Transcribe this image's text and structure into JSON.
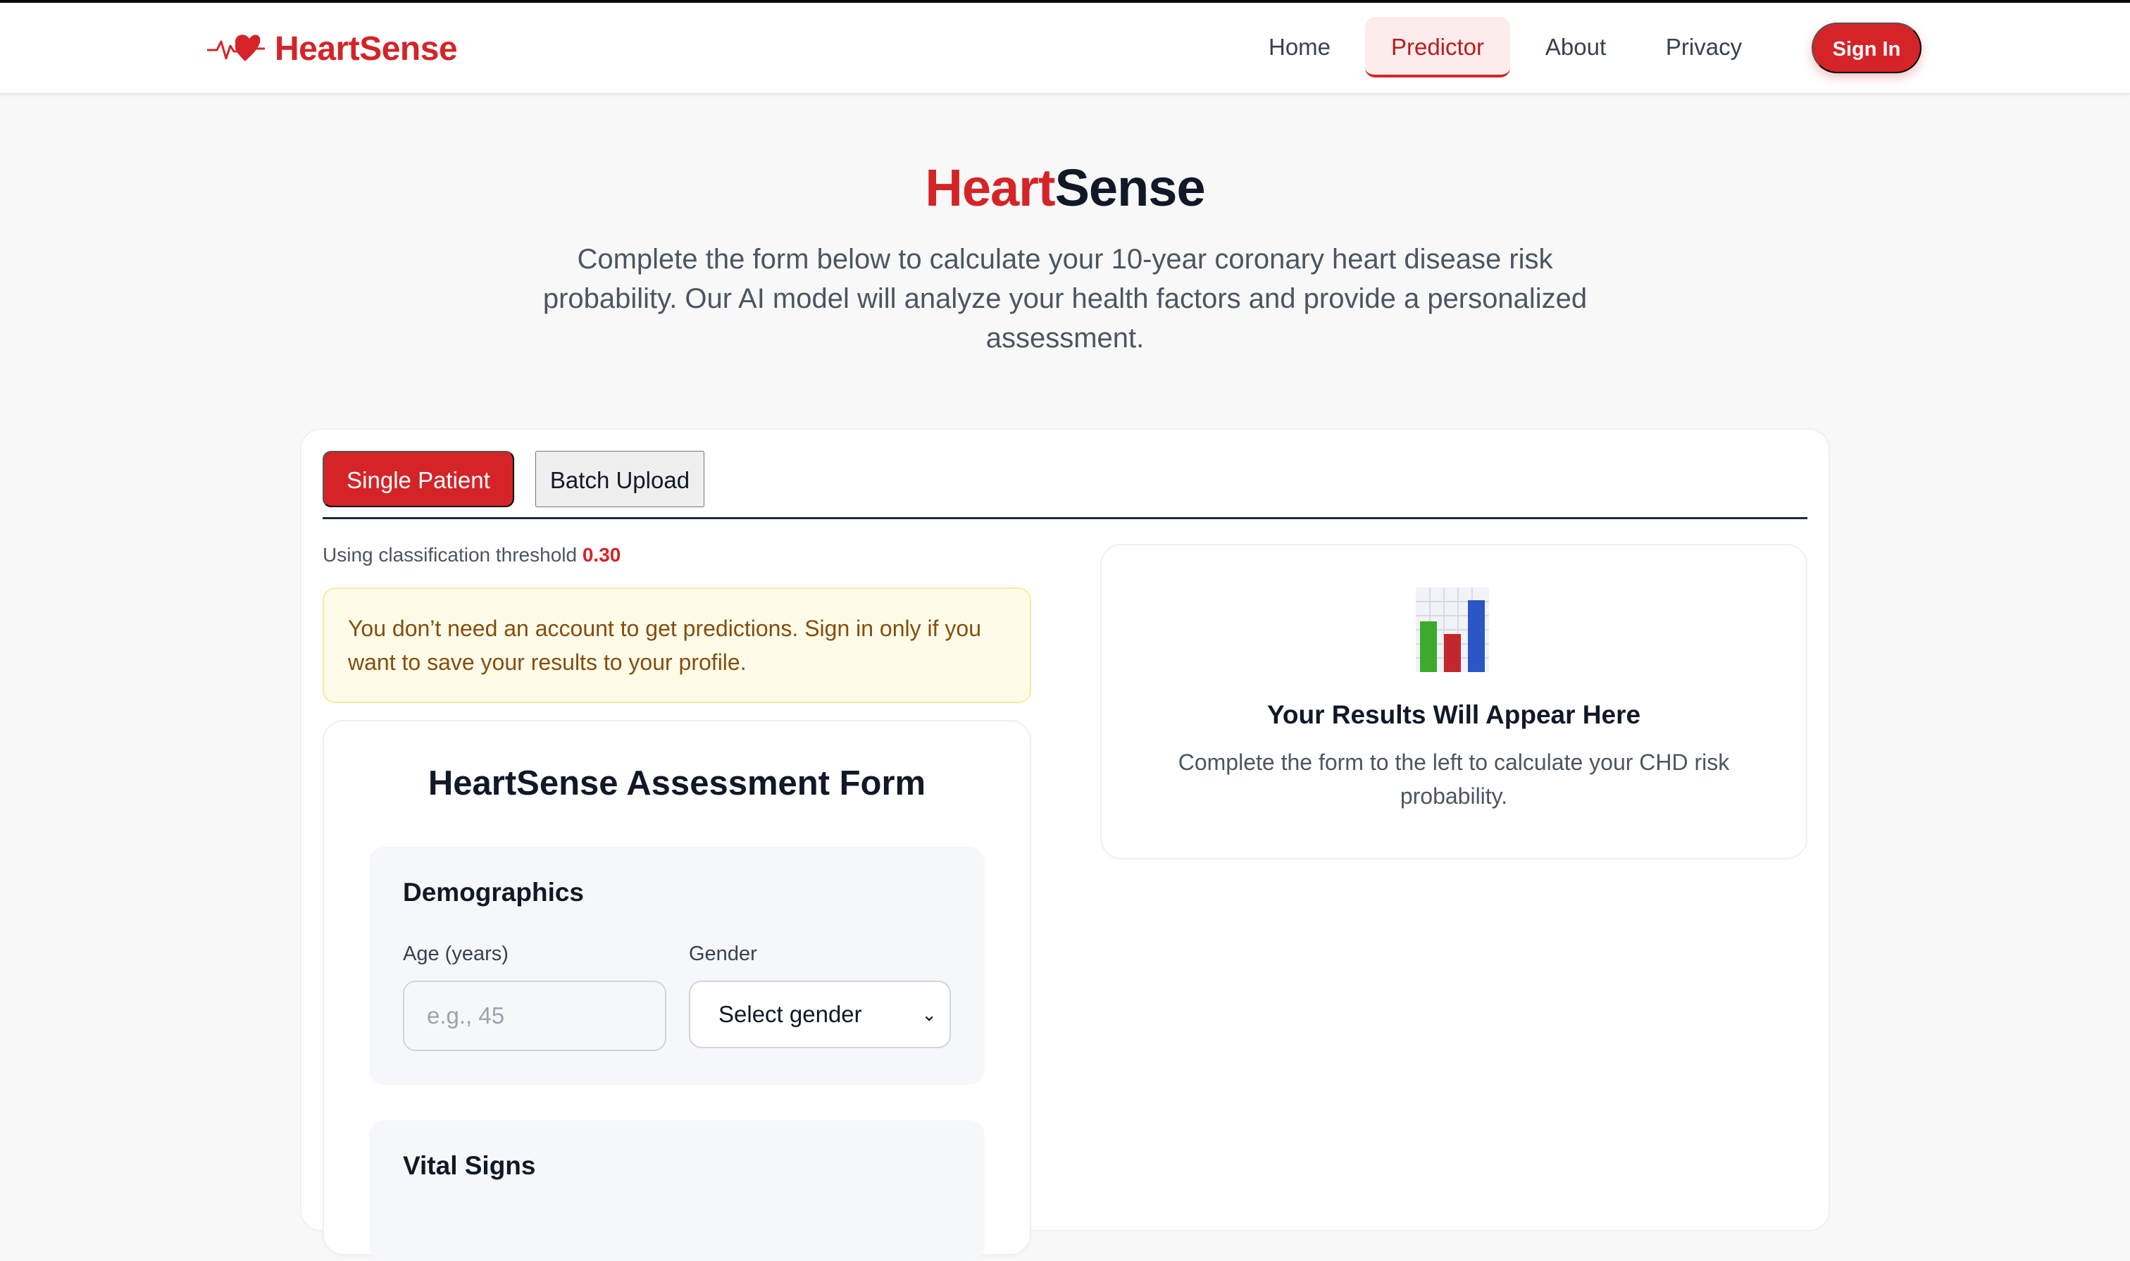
{
  "nav": {
    "brand": "HeartSense",
    "links": [
      "Home",
      "Predictor",
      "About",
      "Privacy"
    ],
    "active": "Predictor",
    "signin": "Sign In"
  },
  "hero": {
    "title_red": "Heart",
    "title_dark": "Sense",
    "subtitle": "Complete the form below to calculate your 10-year coronary heart disease risk probability. Our AI model will analyze your health factors and provide a personalized assessment."
  },
  "tabs": {
    "single": "Single Patient",
    "batch": "Batch Upload",
    "active": "Single Patient"
  },
  "threshold": {
    "label": "Using classification threshold",
    "value": "0.30"
  },
  "notice": "You don’t need an account to get predictions. Sign in only if you want to save your results to your profile.",
  "form": {
    "title": "HeartSense Assessment Form",
    "demographics": {
      "title": "Demographics",
      "age_label": "Age (years)",
      "age_placeholder": "e.g., 45",
      "age_value": "",
      "gender_label": "Gender",
      "gender_selected": "Select gender"
    },
    "vitals": {
      "title": "Vital Signs"
    }
  },
  "results": {
    "icon": "bar-chart-icon",
    "title": "Your Results Will Appear Here",
    "text": "Complete the form to the left to calculate your CHD risk probability."
  },
  "colors": {
    "brand_red": "#d42428",
    "notice_bg": "#fefce8",
    "notice_text": "#854d0e",
    "page_bg": "#f8f8f8"
  }
}
